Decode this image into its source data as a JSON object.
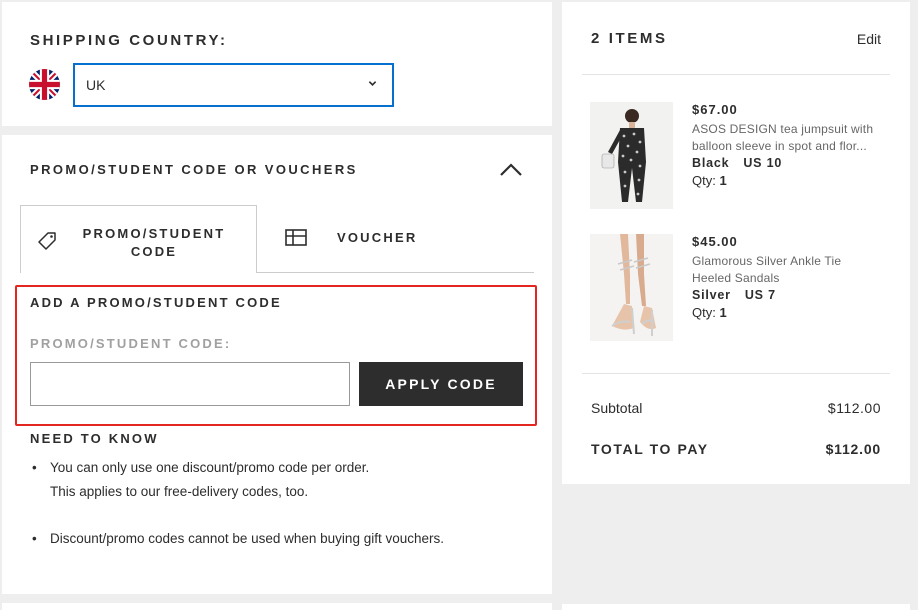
{
  "shipping": {
    "title": "SHIPPING COUNTRY:",
    "country": "UK",
    "flag_icon": "uk-flag-icon"
  },
  "promo": {
    "title": "PROMO/STUDENT CODE OR VOUCHERS",
    "tabs": [
      {
        "label": "PROMO/STUDENT CODE",
        "icon": "tag-icon",
        "active": true
      },
      {
        "label": "VOUCHER",
        "icon": "voucher-icon",
        "active": false
      }
    ],
    "add_title": "ADD A PROMO/STUDENT CODE",
    "code_label": "PROMO/STUDENT CODE:",
    "code_value": "",
    "apply_label": "APPLY CODE",
    "know_title": "NEED TO KNOW",
    "know_items": [
      {
        "lines": [
          "You can only use one discount/promo code per order.",
          "This applies to our free-delivery codes, too."
        ]
      },
      {
        "lines": [
          "Discount/promo codes cannot be used when buying gift vouchers."
        ]
      }
    ],
    "highlight_color": "#e3261f"
  },
  "bag": {
    "title": "2 ITEMS",
    "edit_label": "Edit",
    "items": [
      {
        "price": "$67.00",
        "desc_line1": "ASOS DESIGN tea jumpsuit with",
        "desc_line2": "balloon sleeve in spot and flor...",
        "color": "Black",
        "size": "US 10",
        "qty_label": "Qty:",
        "qty": "1"
      },
      {
        "price": "$45.00",
        "desc_line1": "Glamorous Silver Ankle Tie",
        "desc_line2": "Heeled Sandals",
        "color": "Silver",
        "size": "US 7",
        "qty_label": "Qty:",
        "qty": "1"
      }
    ],
    "subtotal_label": "Subtotal",
    "subtotal_value": "$112.00",
    "total_label": "TOTAL TO PAY",
    "total_value": "$112.00"
  },
  "colors": {
    "accent_blue": "#0770cf",
    "button_dark": "#2d2d2d",
    "background": "#eeeeee"
  }
}
